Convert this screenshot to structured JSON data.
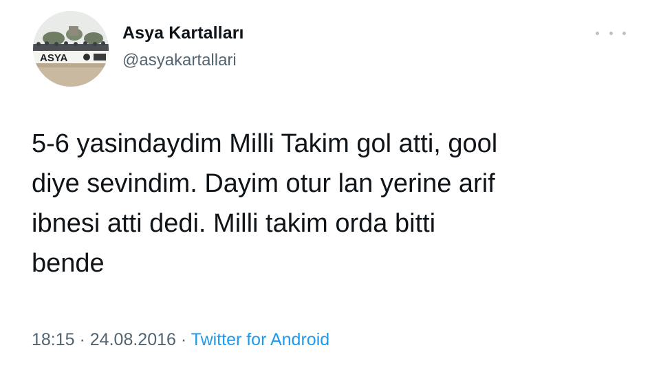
{
  "tweet": {
    "display_name": "Asya Kartalları",
    "handle": "@asyakartallari",
    "text": "5-6 yasindaydim Milli Takim gol atti, gool\ndiye sevindim. Dayim otur lan yerine arif\nibnesi atti dedi. Milli takim orda bitti\nbende",
    "time": "18:15",
    "separator_1": " · ",
    "date": "24.08.2016",
    "separator_2": " · ",
    "source": "Twitter for Android",
    "avatar_text": "ASYA",
    "more_icon": "more-horizontal-icon"
  },
  "colors": {
    "text": "#0f1419",
    "secondary": "#536471",
    "link": "#1d9bf0",
    "background": "#ffffff"
  }
}
